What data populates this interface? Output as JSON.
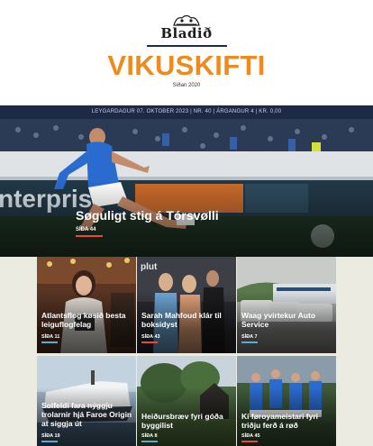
{
  "header": {
    "logo_text": "Bladið",
    "title": "VIKUSKIFTI",
    "since": "Síðan 2020",
    "info": "LEYGARDAGUR 07. OKTOBER 2023 | NR. 40 | ÁRGANGUR 4 | KR. 0,00"
  },
  "hero": {
    "title": "Søguligt stig á Tórsvølli",
    "page": "SÍÐA 44",
    "accent": "#e94a2e",
    "ad_text": "nterpris"
  },
  "cards": [
    {
      "title": "Atlantsflog køsið besta leiguflogfelag",
      "page": "SÍÐA 11",
      "accent": "#5aa9d6"
    },
    {
      "title": "Sarah Mahfoud klár til boksidyst",
      "page": "SÍÐA 43",
      "accent": "#e94a2e",
      "sign_text": "plut"
    },
    {
      "title": "Waag yvirtekur Auto Service",
      "page": "SÍÐA 7",
      "accent": "#5aa9d6"
    },
    {
      "title": "Solfeldi fara nýggju trolarnir hjá Faroe Origin at siggja út",
      "page": "SÍÐA 19",
      "accent": "#5aa9d6"
    },
    {
      "title": "Heiðursbræv fyri góða byggilist",
      "page": "SÍÐA 8",
      "accent": "#5aa9d6"
    },
    {
      "title": "Kí føroyameistari fyri triðju ferð á røð",
      "page": "SÍÐA 45",
      "accent": "#e94a2e"
    }
  ]
}
